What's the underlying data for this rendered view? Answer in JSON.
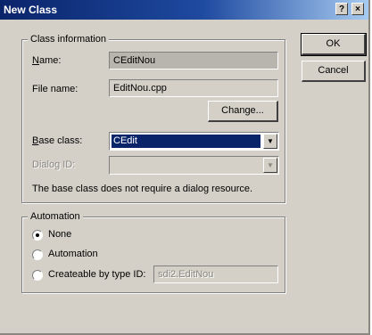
{
  "window": {
    "title": "New Class",
    "help_glyph": "?",
    "close_glyph": "×"
  },
  "class_info": {
    "group_label": "Class information",
    "name_label": "Name:",
    "name_value": "CEditNou",
    "filename_label": "File name:",
    "filename_value": "EditNou.cpp",
    "change_button": "Change...",
    "base_class_label": "Base class:",
    "base_class_value": "CEdit",
    "dialog_id_label": "Dialog ID:",
    "dialog_id_value": "",
    "note": "The base class does not require a dialog resource."
  },
  "automation": {
    "group_label": "Automation",
    "options": [
      "None",
      "Automation",
      "Createable by type ID:"
    ],
    "selected_index": 0,
    "type_id_value": "sdi2.EditNou"
  },
  "buttons": {
    "ok": "OK",
    "cancel": "Cancel"
  },
  "icons": {
    "dropdown": "dropdown-arrow-icon",
    "help": "help-icon",
    "close": "close-icon"
  },
  "colors": {
    "titlebar": "#0a246a",
    "dialog_bg": "#d4d0c8",
    "selection": "#0a246a"
  }
}
